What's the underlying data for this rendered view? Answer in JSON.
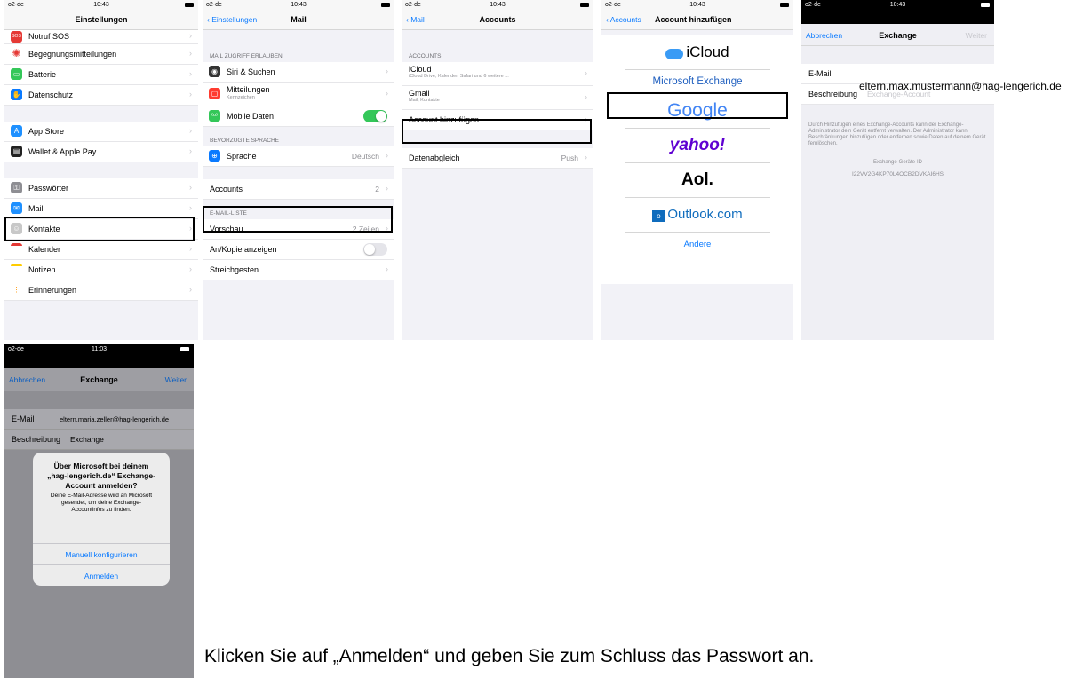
{
  "caption": "Klicken Sie auf „Anmelden“ und geben Sie zum Schluss das Passwort an.",
  "status": {
    "carrier": "o2-de",
    "time": "10:43",
    "time2": "11:03"
  },
  "s1": {
    "title": "Einstellungen",
    "items": [
      "Notruf SOS",
      "Begegnungsmitteilungen",
      "Batterie",
      "Datenschutz",
      "App Store",
      "Wallet & Apple Pay",
      "Passwörter",
      "Mail",
      "Kontakte",
      "Kalender",
      "Notizen",
      "Erinnerungen"
    ]
  },
  "s2": {
    "back": "Einstellungen",
    "title": "Mail",
    "section1": "MAIL ZUGRIFF ERLAUBEN",
    "siri": "Siri & Suchen",
    "mitteilungen": "Mitteilungen",
    "mitteilungen_sub": "Kennzeichen",
    "mobile": "Mobile Daten",
    "section2": "BEVORZUGTE SPRACHE",
    "sprache": "Sprache",
    "sprache_val": "Deutsch",
    "accounts": "Accounts",
    "accounts_val": "2",
    "section3": "E-MAIL-LISTE",
    "vorschau": "Vorschau",
    "vorschau_val": "2 Zeilen",
    "kopie": "An/Kopie anzeigen",
    "streich": "Streichgesten"
  },
  "s3": {
    "back": "Mail",
    "title": "Accounts",
    "section": "ACCOUNTS",
    "icloud": "iCloud",
    "icloud_sub": "iCloud Drive, Kalender, Safari und 6 weitere ...",
    "gmail": "Gmail",
    "gmail_sub": "Mail, Kontakte",
    "add": "Account hinzufügen",
    "abgleich": "Datenabgleich",
    "abgleich_val": "Push"
  },
  "s4": {
    "back": "Accounts",
    "title": "Account hinzufügen",
    "icloud": "iCloud",
    "exchange": "Microsoft Exchange",
    "google": "Google",
    "yahoo": "yahoo!",
    "aol": "Aol.",
    "outlook": "Outlook.com",
    "andere": "Andere"
  },
  "s5": {
    "cancel": "Abbrechen",
    "title": "Exchange",
    "next": "Weiter",
    "email_label": "E-Mail",
    "email_value": "eltern.max.mustermann@hag-lengerich.de",
    "desc_label": "Beschreibung",
    "desc_placeholder": "Exchange-Account",
    "info": "Durch Hinzufügen eines Exchange-Accounts kann der Exchange-Administrator dein Gerät entfernt verwalten. Der Administrator kann Beschränkungen hinzufügen oder entfernen sowie Daten auf deinem Gerät fernlöschen.",
    "device_id_label": "Exchange-Geräte-ID",
    "device_id": "I22VV2G4KP70L4OCB2DVKAI6HS"
  },
  "s6": {
    "cancel": "Abbrechen",
    "title": "Exchange",
    "next": "Weiter",
    "email_label": "E-Mail",
    "email_value": "eltern.maria.zeller@hag-lengerich.de",
    "desc_label": "Beschreibung",
    "desc_value": "Exchange",
    "alert_title": "Über Microsoft bei deinem „hag-lengerich.de“ Exchange-Account anmelden?",
    "alert_body": "Deine E-Mail-Adresse wird an Microsoft gesendet, um deine Exchange-Accountinfos zu finden.",
    "manual": "Manuell konfigurieren",
    "login": "Anmelden"
  },
  "colors": {
    "blue": "#0a7aff",
    "green": "#34c759"
  }
}
